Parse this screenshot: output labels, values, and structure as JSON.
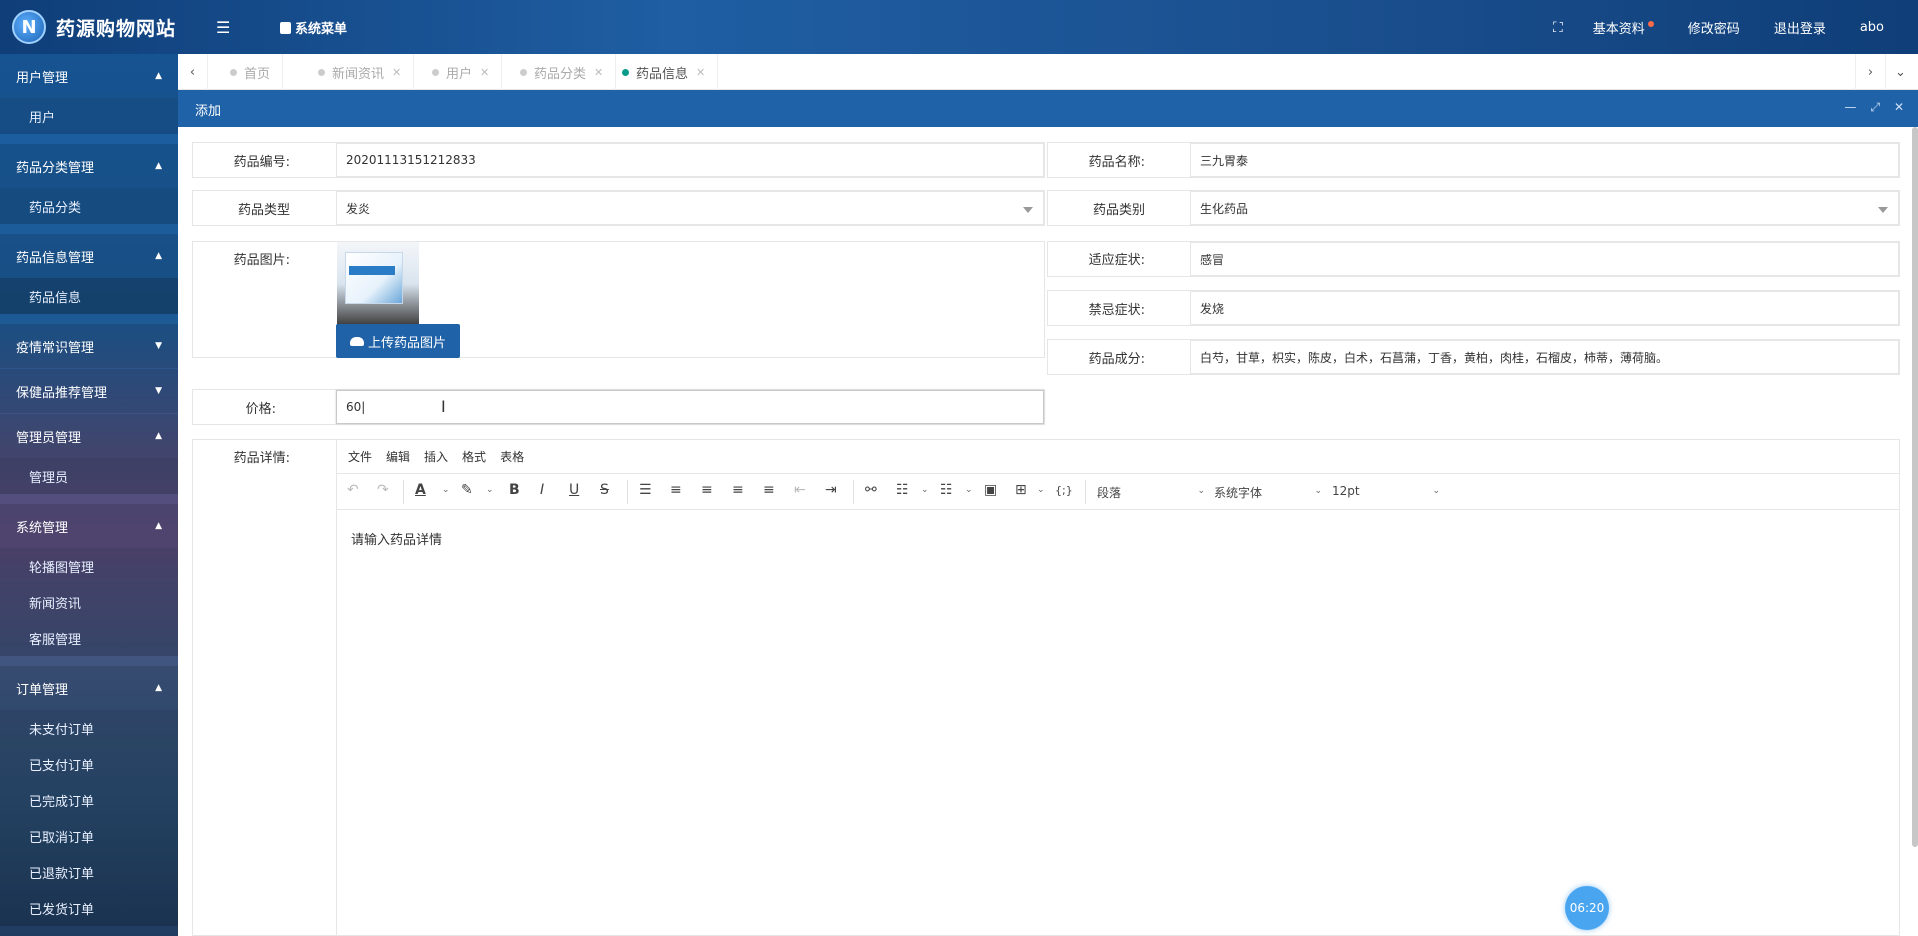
{
  "header": {
    "logo_letter": "N",
    "site_title": "药源购物网站",
    "menu_toggle_glyph": "☰",
    "system_menu": "系统菜单",
    "fullscreen_glyph": "⛶",
    "profile": "基本资料",
    "change_password": "修改密码",
    "logout": "退出登录",
    "username": "abo",
    "notification_dot_color": "#ff6b4a"
  },
  "sidebar": {
    "groups": [
      {
        "label": "用户管理",
        "arrow": "▲",
        "items": [
          "用户"
        ]
      },
      {
        "label": "药品分类管理",
        "arrow": "▲",
        "items": [
          "药品分类"
        ]
      },
      {
        "label": "药品信息管理",
        "arrow": "▲",
        "items": [
          "药品信息"
        ]
      },
      {
        "label": "疫情常识管理",
        "arrow": "▼",
        "items": []
      },
      {
        "label": "保健品推荐管理",
        "arrow": "▼",
        "items": []
      },
      {
        "label": "管理员管理",
        "arrow": "▲",
        "items": [
          "管理员"
        ]
      },
      {
        "label": "系统管理",
        "arrow": "▲",
        "items": [
          "轮播图管理",
          "新闻资讯",
          "客服管理"
        ]
      },
      {
        "label": "订单管理",
        "arrow": "▲",
        "items": [
          "未支付订单",
          "已支付订单",
          "已完成订单",
          "已取消订单",
          "已退款订单",
          "已发货订单"
        ]
      }
    ]
  },
  "tabs": {
    "prev": "‹",
    "next": "›",
    "more": "⌄",
    "close_glyph": "✕",
    "items": [
      {
        "label": "首页",
        "active": false
      },
      {
        "label": "新闻资讯",
        "active": false
      },
      {
        "label": "用户",
        "active": false
      },
      {
        "label": "药品分类",
        "active": false
      },
      {
        "label": "药品信息",
        "active": true
      }
    ]
  },
  "dialog": {
    "title": "添加",
    "min_glyph": "—",
    "max_glyph": "⤢",
    "close_glyph": "✕"
  },
  "form": {
    "code_label": "药品编号:",
    "code_value": "20201113151212833",
    "name_label": "药品名称:",
    "name_value": "三九胃泰",
    "type_label": "药品类型",
    "type_value": "发炎",
    "category_label": "药品类别",
    "category_value": "生化药品",
    "image_label": "药品图片:",
    "upload_button": "上传药品图片",
    "indication_label": "适应症状:",
    "indication_value": "感冒",
    "contra_label": "禁忌症状:",
    "contra_value": "发烧",
    "ingredient_label": "药品成分:",
    "ingredient_value": "白芍，甘草，枳实，陈皮，白术，石菖蒲，丁香，黄柏，肉桂，石榴皮，柿蒂，薄荷脑。",
    "price_label": "价格:",
    "price_value": "60|",
    "detail_label": "药品详情:"
  },
  "editor": {
    "menu": [
      "文件",
      "编辑",
      "插入",
      "格式",
      "表格"
    ],
    "toolbar_icons": [
      "undo-icon",
      "redo-icon",
      "font-color-icon",
      "highlight-icon",
      "bold-icon",
      "italic-icon",
      "underline-icon",
      "strikethrough-icon",
      "line-height-icon",
      "align-left-icon",
      "align-center-icon",
      "align-right-icon",
      "align-justify-icon",
      "outdent-icon",
      "indent-icon",
      "link-icon",
      "bullet-list-icon",
      "numbered-list-icon",
      "image-icon",
      "table-icon",
      "code-icon"
    ],
    "glyphs": {
      "undo": "↶",
      "redo": "↷",
      "font_color": "A",
      "highlight": "✎",
      "bold": "B",
      "italic": "I",
      "underline": "U",
      "strike": "S",
      "line_height": "☰",
      "align_left": "≡",
      "align_center": "≡",
      "align_right": "≡",
      "justify": "≡",
      "outdent": "⇤",
      "indent": "⇥",
      "link": "⚯",
      "bullet": "☷",
      "numbered": "☷",
      "image": "▣",
      "table": "⊞",
      "code": "{;}",
      "chev": "⌄"
    },
    "paragraph_select": "段落",
    "font_select": "系统字体",
    "size_select": "12pt",
    "placeholder": "请输入药品详情"
  },
  "cursor_glyph": "I",
  "timer": "06:20"
}
